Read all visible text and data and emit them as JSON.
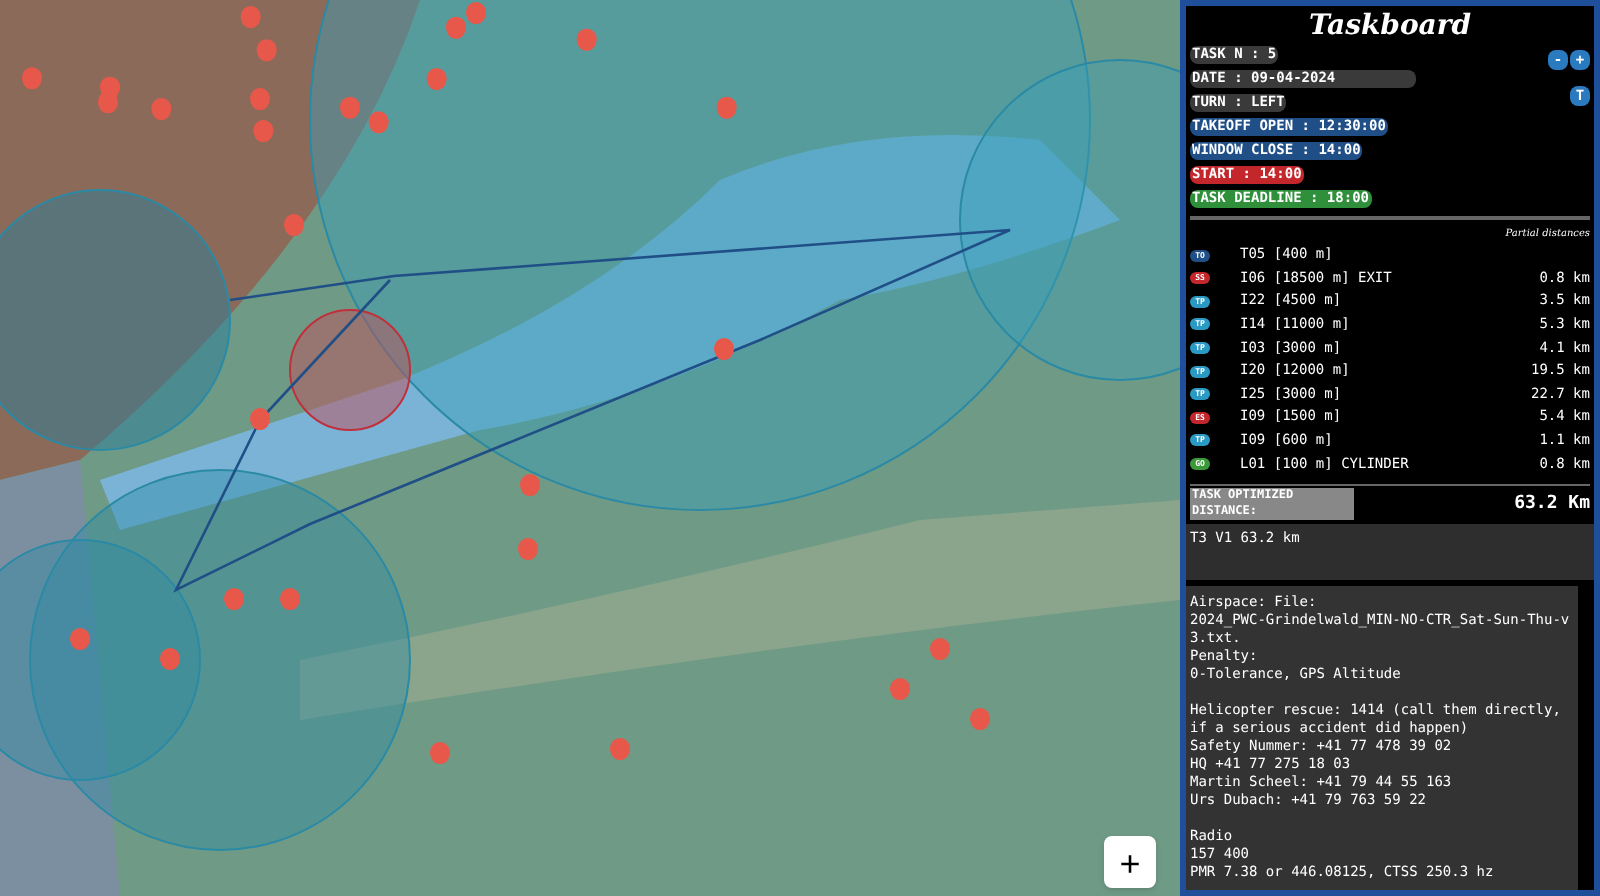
{
  "map": {
    "zoom_button": "+"
  },
  "taskboard": {
    "title": "Taskboard",
    "buttons": [
      "-",
      "+"
    ],
    "turn_button": "T",
    "info": [
      {
        "text": "TASK N : 5",
        "kind": "plain"
      },
      {
        "text": "DATE : 09-04-2024",
        "kind": "wide"
      },
      {
        "text": "TURN : LEFT",
        "kind": "plain"
      },
      {
        "text": "TAKEOFF OPEN : 12:30:00",
        "kind": "window"
      },
      {
        "text": "WINDOW CLOSE : 14:00",
        "kind": "window"
      },
      {
        "text": "START : 14:00",
        "kind": "start"
      },
      {
        "text": "TASK DEADLINE : 18:00",
        "kind": "deadline"
      }
    ],
    "partial_heading": "Partial distances",
    "turnpoints": [
      {
        "badge": "TO",
        "kind": "takeoff",
        "name": "T05 [400 m]"
      },
      {
        "badge": "SS",
        "kind": "start",
        "name": "I06 [18500 m] EXIT",
        "distance": "0.8 km"
      },
      {
        "badge": "TP",
        "kind": "turnpoint",
        "name": "I22 [4500 m]",
        "distance": "3.5 km"
      },
      {
        "badge": "TP",
        "kind": "turnpoint",
        "name": "I14 [11000 m]",
        "distance": "5.3 km"
      },
      {
        "badge": "TP",
        "kind": "turnpoint",
        "name": "I03 [3000 m]",
        "distance": "4.1 km"
      },
      {
        "badge": "TP",
        "kind": "turnpoint",
        "name": "I20 [12000 m]",
        "distance": "19.5 km"
      },
      {
        "badge": "TP",
        "kind": "turnpoint",
        "name": "I25 [3000 m]",
        "distance": "22.7 km"
      },
      {
        "badge": "ES",
        "kind": "end",
        "name": "I09 [1500 m]",
        "distance": "5.4 km"
      },
      {
        "badge": "TP",
        "kind": "turnpoint",
        "name": "I09 [600 m]",
        "distance": "1.1 km"
      },
      {
        "badge": "GO",
        "kind": "goal",
        "name": "L01 [100 m] CYLINDER",
        "distance": "0.8 km"
      }
    ],
    "optimized_label": "TASK OPTIMIZED DISTANCE:",
    "optimized_value": "63.2 Km",
    "task_note": "T3 V1 63.2 km",
    "notes": [
      [
        "Airspace: File:",
        "2024_PWC-Grindelwald_MIN-NO-CTR_Sat-Sun-Thu-v3.txt.",
        "Penalty:",
        "0-Tolerance, GPS Altitude"
      ],
      [
        "Helicopter rescue: 1414 (call them directly, if a serious accident did happen)",
        "Safety Nummer: +41 77 478 39 02",
        "HQ +41 77 275 18 03",
        "Martin Scheel: +41 79 44 55 163",
        "Urs Dubach: +41 79 763 59 22"
      ],
      [
        "Radio",
        "157 400",
        "PMR 7.38 or 446.08125, CTSS 250.3 hz"
      ]
    ]
  }
}
